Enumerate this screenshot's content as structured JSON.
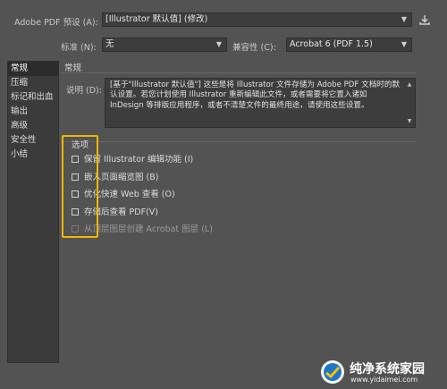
{
  "header": {
    "preset_label": "Adobe PDF 预设 (A):",
    "preset_value": "[Illustrator 默认值] (修改)",
    "standard_label": "标准 (N):",
    "standard_value": "无",
    "compat_label": "兼容性 (C):",
    "compat_value": "Acrobat 6 (PDF 1.5)"
  },
  "sidebar": {
    "items": [
      {
        "label": "常规"
      },
      {
        "label": "压缩"
      },
      {
        "label": "标记和出血"
      },
      {
        "label": "输出"
      },
      {
        "label": "高级"
      },
      {
        "label": "安全性"
      },
      {
        "label": "小结"
      }
    ]
  },
  "main": {
    "section_title": "常规",
    "desc_label": "说明 (D):",
    "desc_text": "[基于\"Illustrator 默认值\"] 这些是将 Illustrator 文件存储为 Adobe PDF 文档时的默认设置。若您计划使用 Illustrator 重新编辑此文件，或者需要将它置入诸如 InDesign 等排版应用程序，或者不清楚文件的最终用途，请使用这些设置。",
    "options_title": "选项",
    "options": [
      {
        "label": "保留 Illustrator 编辑功能 (I)",
        "checked": false,
        "enabled": true
      },
      {
        "label": "嵌入页面缩览图 (B)",
        "checked": false,
        "enabled": true
      },
      {
        "label": "优化快速 Web 查看 (O)",
        "checked": false,
        "enabled": true
      },
      {
        "label": "存储后查看 PDF(V)",
        "checked": false,
        "enabled": true
      },
      {
        "label": "从顶层图层创建 Acrobat 图层 (L)",
        "checked": false,
        "enabled": false
      }
    ]
  },
  "watermark": {
    "title": "纯净系统家园",
    "url": "www.yidaimei.com"
  },
  "colors": {
    "highlight": "#f0b800",
    "background": "#535353"
  }
}
